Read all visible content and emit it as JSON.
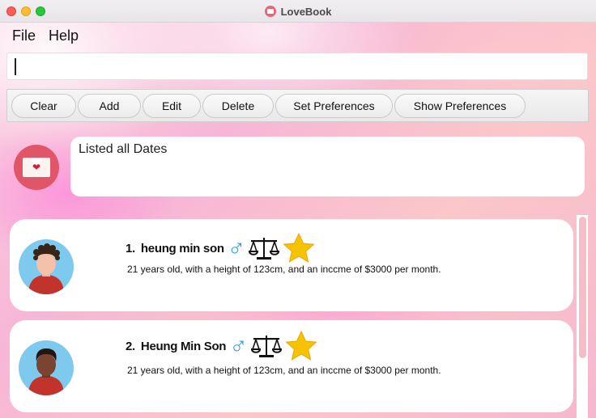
{
  "window": {
    "title": "LoveBook"
  },
  "menu": {
    "file": "File",
    "help": "Help"
  },
  "command_box": {
    "value": "",
    "placeholder": ""
  },
  "toolbar": {
    "clear": "Clear",
    "add": "Add",
    "edit": "Edit",
    "delete": "Delete",
    "set_preferences": "Set Preferences",
    "show_preferences": "Show Preferences"
  },
  "result": {
    "message": "Listed all Dates"
  },
  "dates": [
    {
      "index": "1.",
      "name": "heung min son",
      "gender_icon": "male-symbol-icon",
      "horoscope_icon": "libra-scales-icon",
      "star_icon": "star-icon",
      "description": "21 years old, with a height of 123cm, and an inccme of $3000 per month."
    },
    {
      "index": "2.",
      "name": "Heung Min Son",
      "gender_icon": "male-symbol-icon",
      "horoscope_icon": "libra-scales-icon",
      "star_icon": "star-icon",
      "description": "21 years old, with a height of 123cm, and an inccme of $3000 per month."
    }
  ],
  "colors": {
    "accent_pink": "#e05567",
    "male_blue": "#2fa3e6",
    "star_gold": "#f7c200",
    "avatar_bg": "#7ec9ee"
  }
}
